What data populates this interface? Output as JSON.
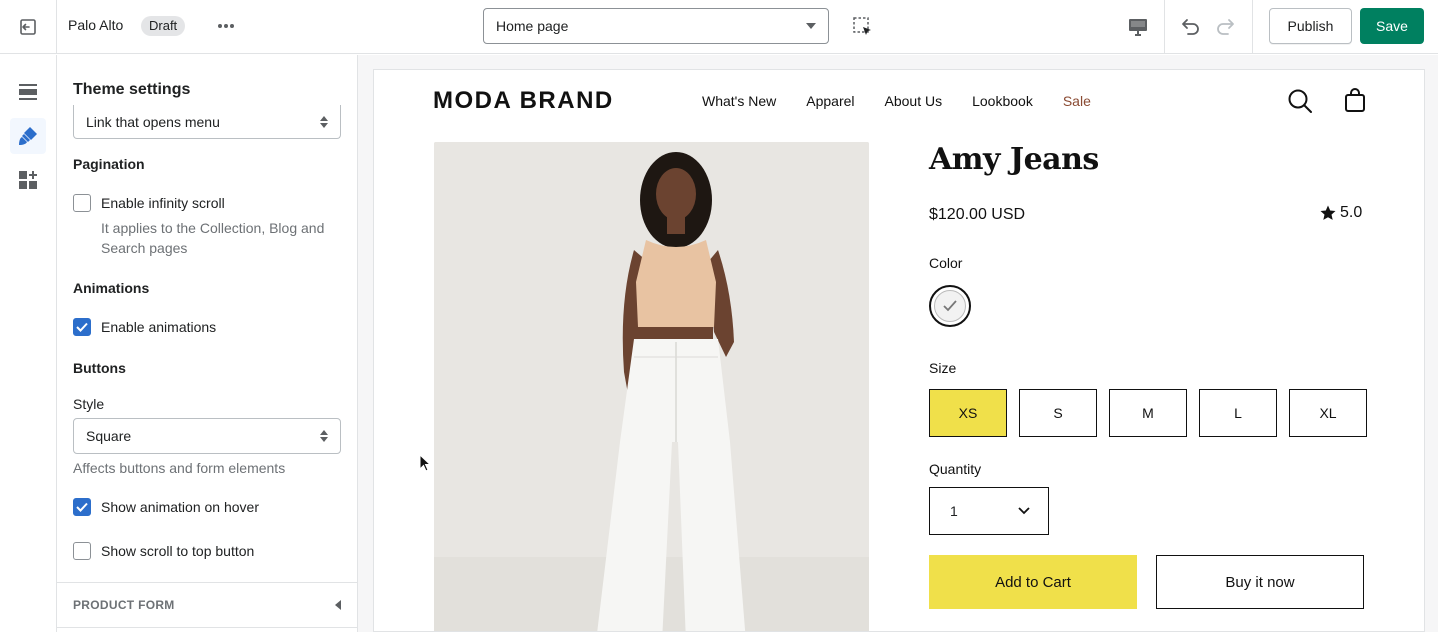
{
  "topbar": {
    "store_name": "Palo Alto",
    "status_badge": "Draft",
    "page_select": "Home page",
    "publish_label": "Publish",
    "save_label": "Save"
  },
  "rail": {
    "items": [
      {
        "icon": "sections-icon",
        "active": false
      },
      {
        "icon": "theme-settings-brush-icon",
        "active": true
      },
      {
        "icon": "app-blocks-icon",
        "active": false
      }
    ]
  },
  "panel": {
    "title": "Theme settings",
    "menu_select": "Link that opens menu",
    "pagination": {
      "heading": "Pagination",
      "infinity_scroll_label": "Enable infinity scroll",
      "infinity_scroll_checked": false,
      "infinity_scroll_help": "It applies to the Collection, Blog and Search pages"
    },
    "animations": {
      "heading": "Animations",
      "enable_label": "Enable animations",
      "enable_checked": true
    },
    "buttons": {
      "heading": "Buttons",
      "style_label": "Style",
      "style_value": "Square",
      "style_help": "Affects buttons and form elements",
      "hover_label": "Show animation on hover",
      "hover_checked": true,
      "scroll_top_label": "Show scroll to top button",
      "scroll_top_checked": false
    },
    "collapsible_section": "PRODUCT FORM"
  },
  "preview": {
    "brand": "MODA BRAND",
    "nav": [
      "What's New",
      "Apparel",
      "About Us",
      "Lookbook",
      "Sale"
    ],
    "accent_sale_color": "#8a4a32",
    "product": {
      "title": "Amy Jeans",
      "price": "$120.00 USD",
      "rating": "5.0",
      "color_label": "Color",
      "size_label": "Size",
      "sizes": [
        "XS",
        "S",
        "M",
        "L",
        "XL"
      ],
      "selected_size": "XS",
      "quantity_label": "Quantity",
      "quantity_value": "1",
      "add_to_cart": "Add to Cart",
      "buy_now": "Buy it now",
      "highlight_color": "#f0e04a"
    }
  }
}
